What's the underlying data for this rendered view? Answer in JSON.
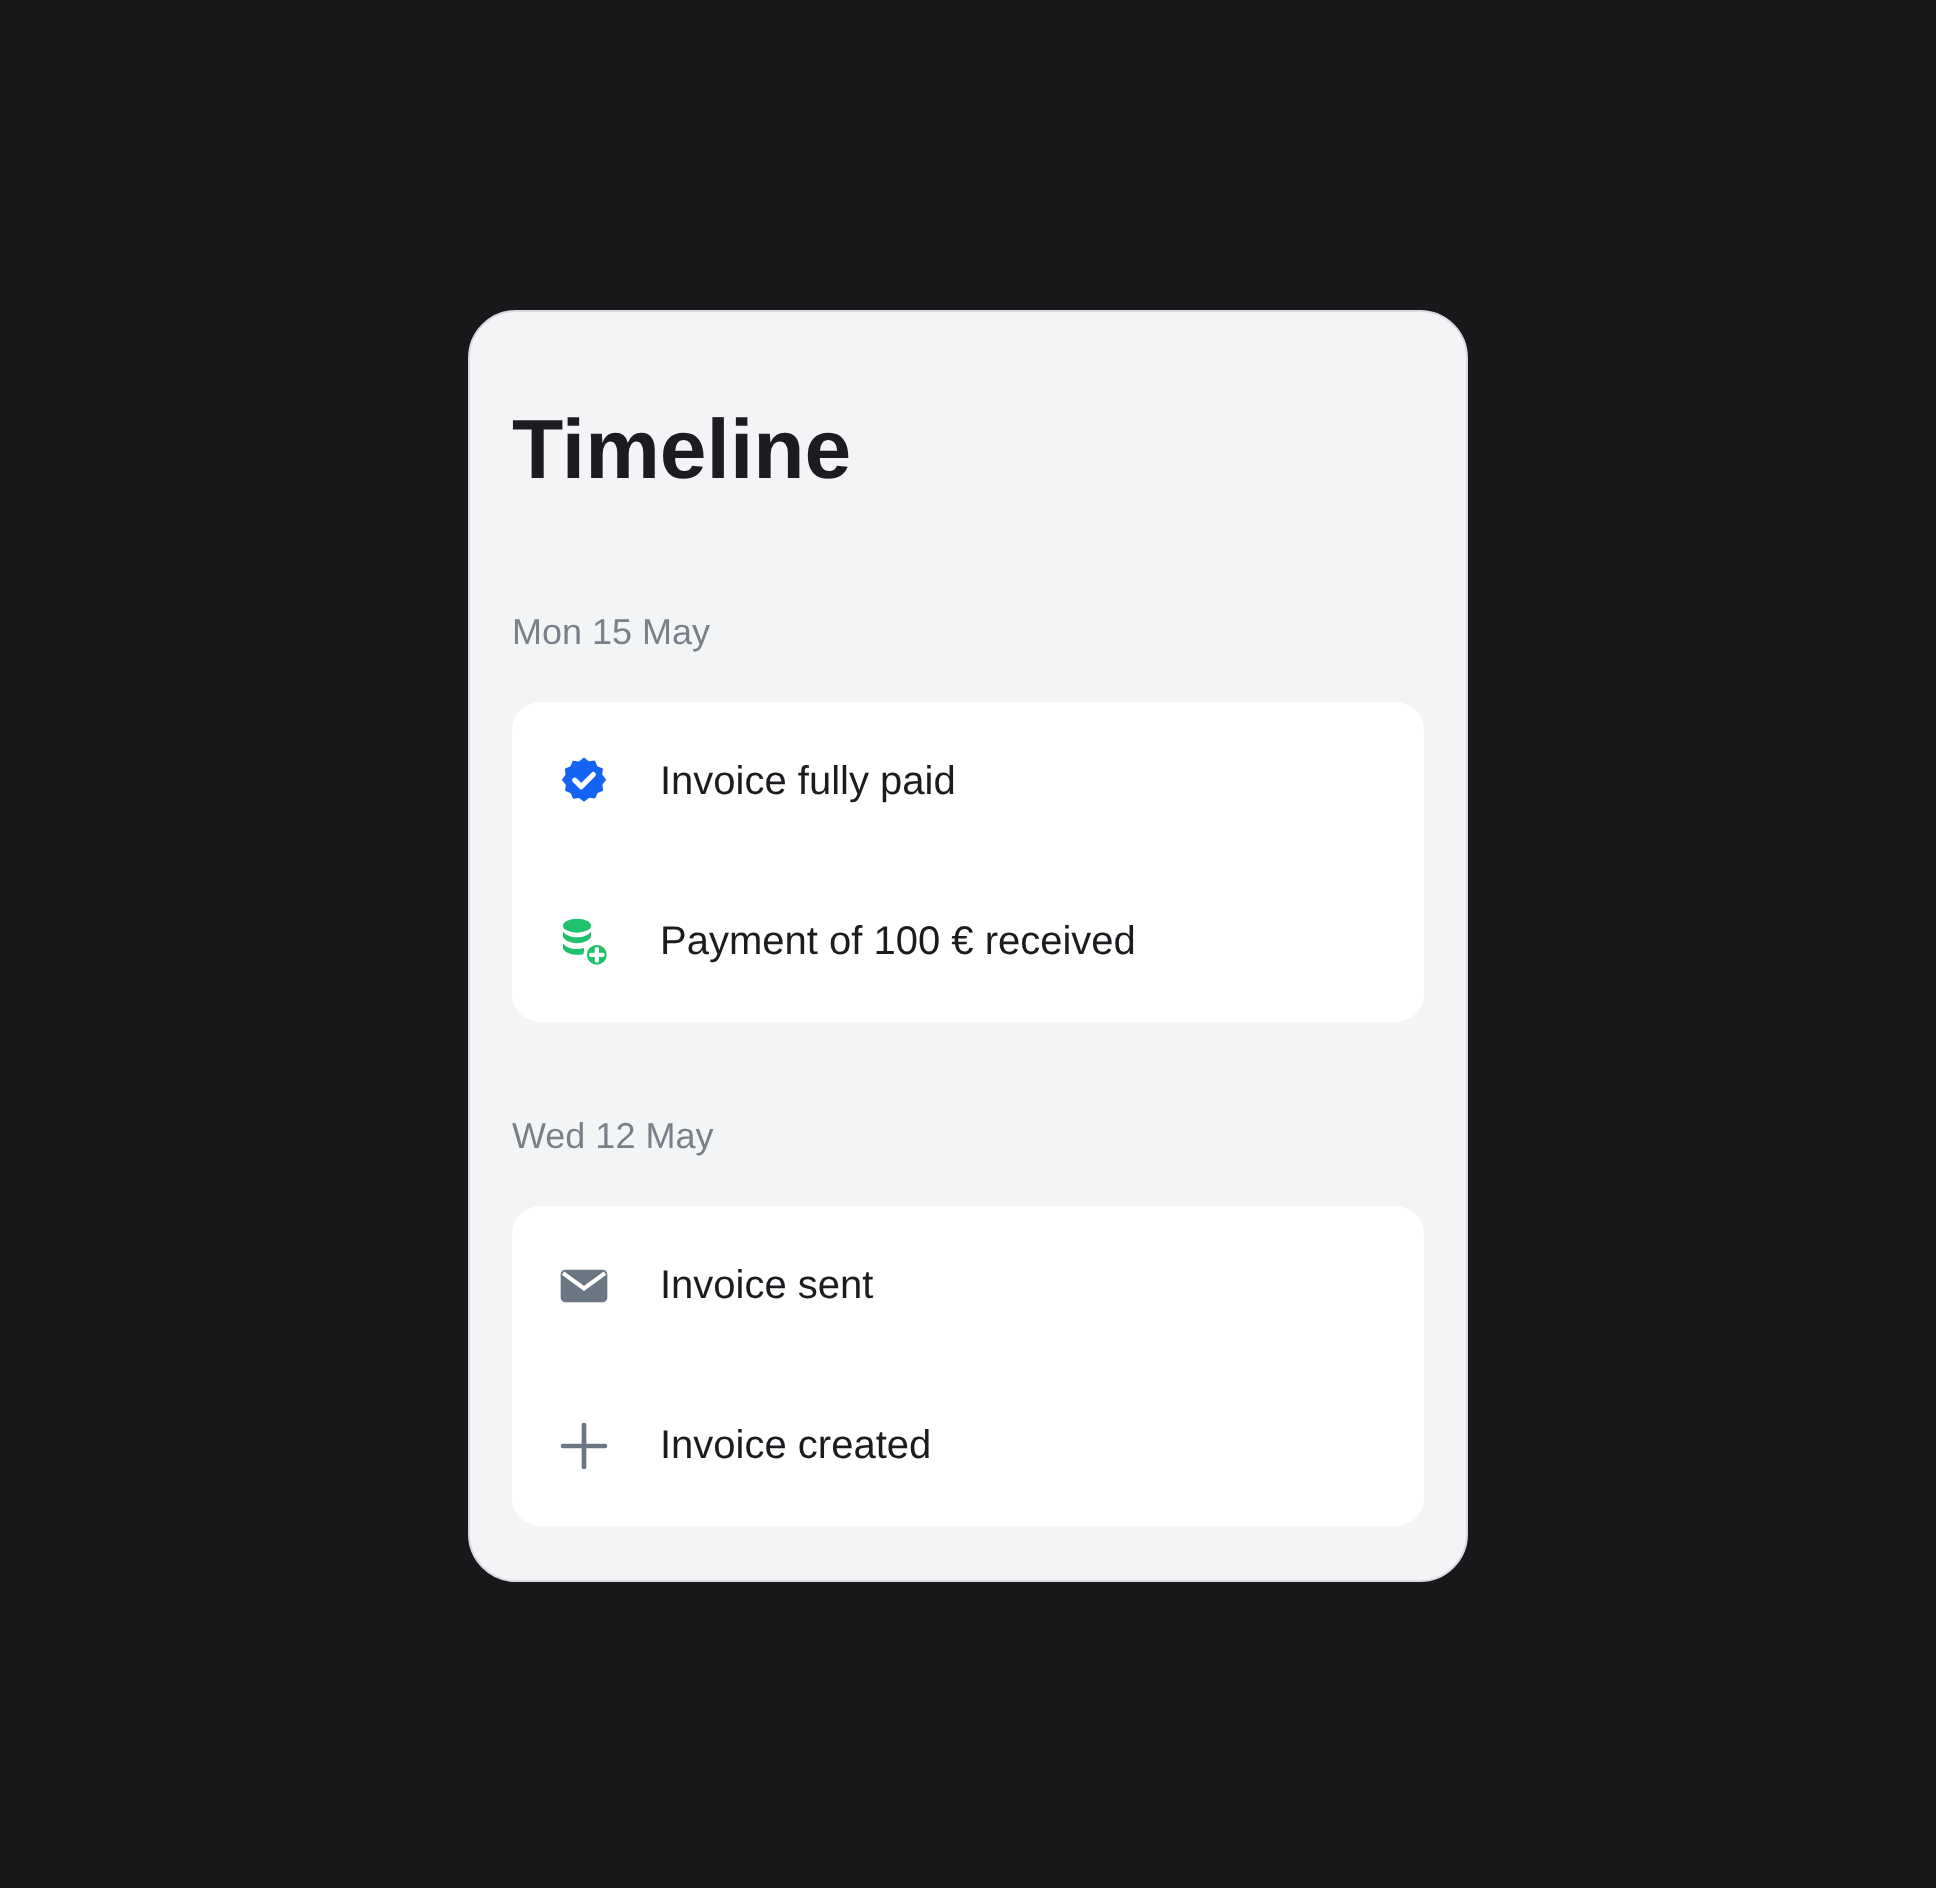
{
  "title": "Timeline",
  "groups": [
    {
      "date": "Mon 15 May",
      "events": [
        {
          "kind": "verified",
          "label": "Invoice fully paid"
        },
        {
          "kind": "payment",
          "label": "Payment of 100 € received"
        }
      ]
    },
    {
      "date": "Wed 12 May",
      "events": [
        {
          "kind": "mail",
          "label": "Invoice sent"
        },
        {
          "kind": "created",
          "label": "Invoice created"
        }
      ]
    }
  ]
}
